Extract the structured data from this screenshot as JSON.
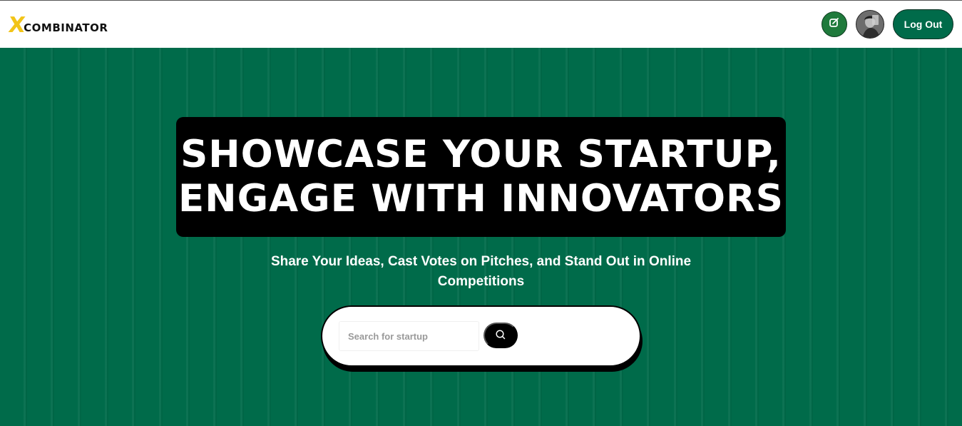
{
  "navbar": {
    "logo_mark": "X",
    "logo_text": "COMBINATOR",
    "create_icon": "edit-square-icon",
    "avatar_alt": "user avatar",
    "logout_label": "Log Out"
  },
  "hero": {
    "headline_line1": "SHOWCASE YOUR STARTUP,",
    "headline_line2": "ENGAGE WITH INNOVATORS",
    "subtitle": "Share Your Ideas, Cast Votes on Pitches, and Stand Out in Online Competitions",
    "search_placeholder": "Search for startup",
    "search_value": "",
    "search_icon": "search-icon"
  },
  "colors": {
    "brand_green": "#006b4a",
    "logo_yellow": "#f2c417",
    "create_button_green": "#1f7a3c",
    "headline_bg": "#000000"
  }
}
